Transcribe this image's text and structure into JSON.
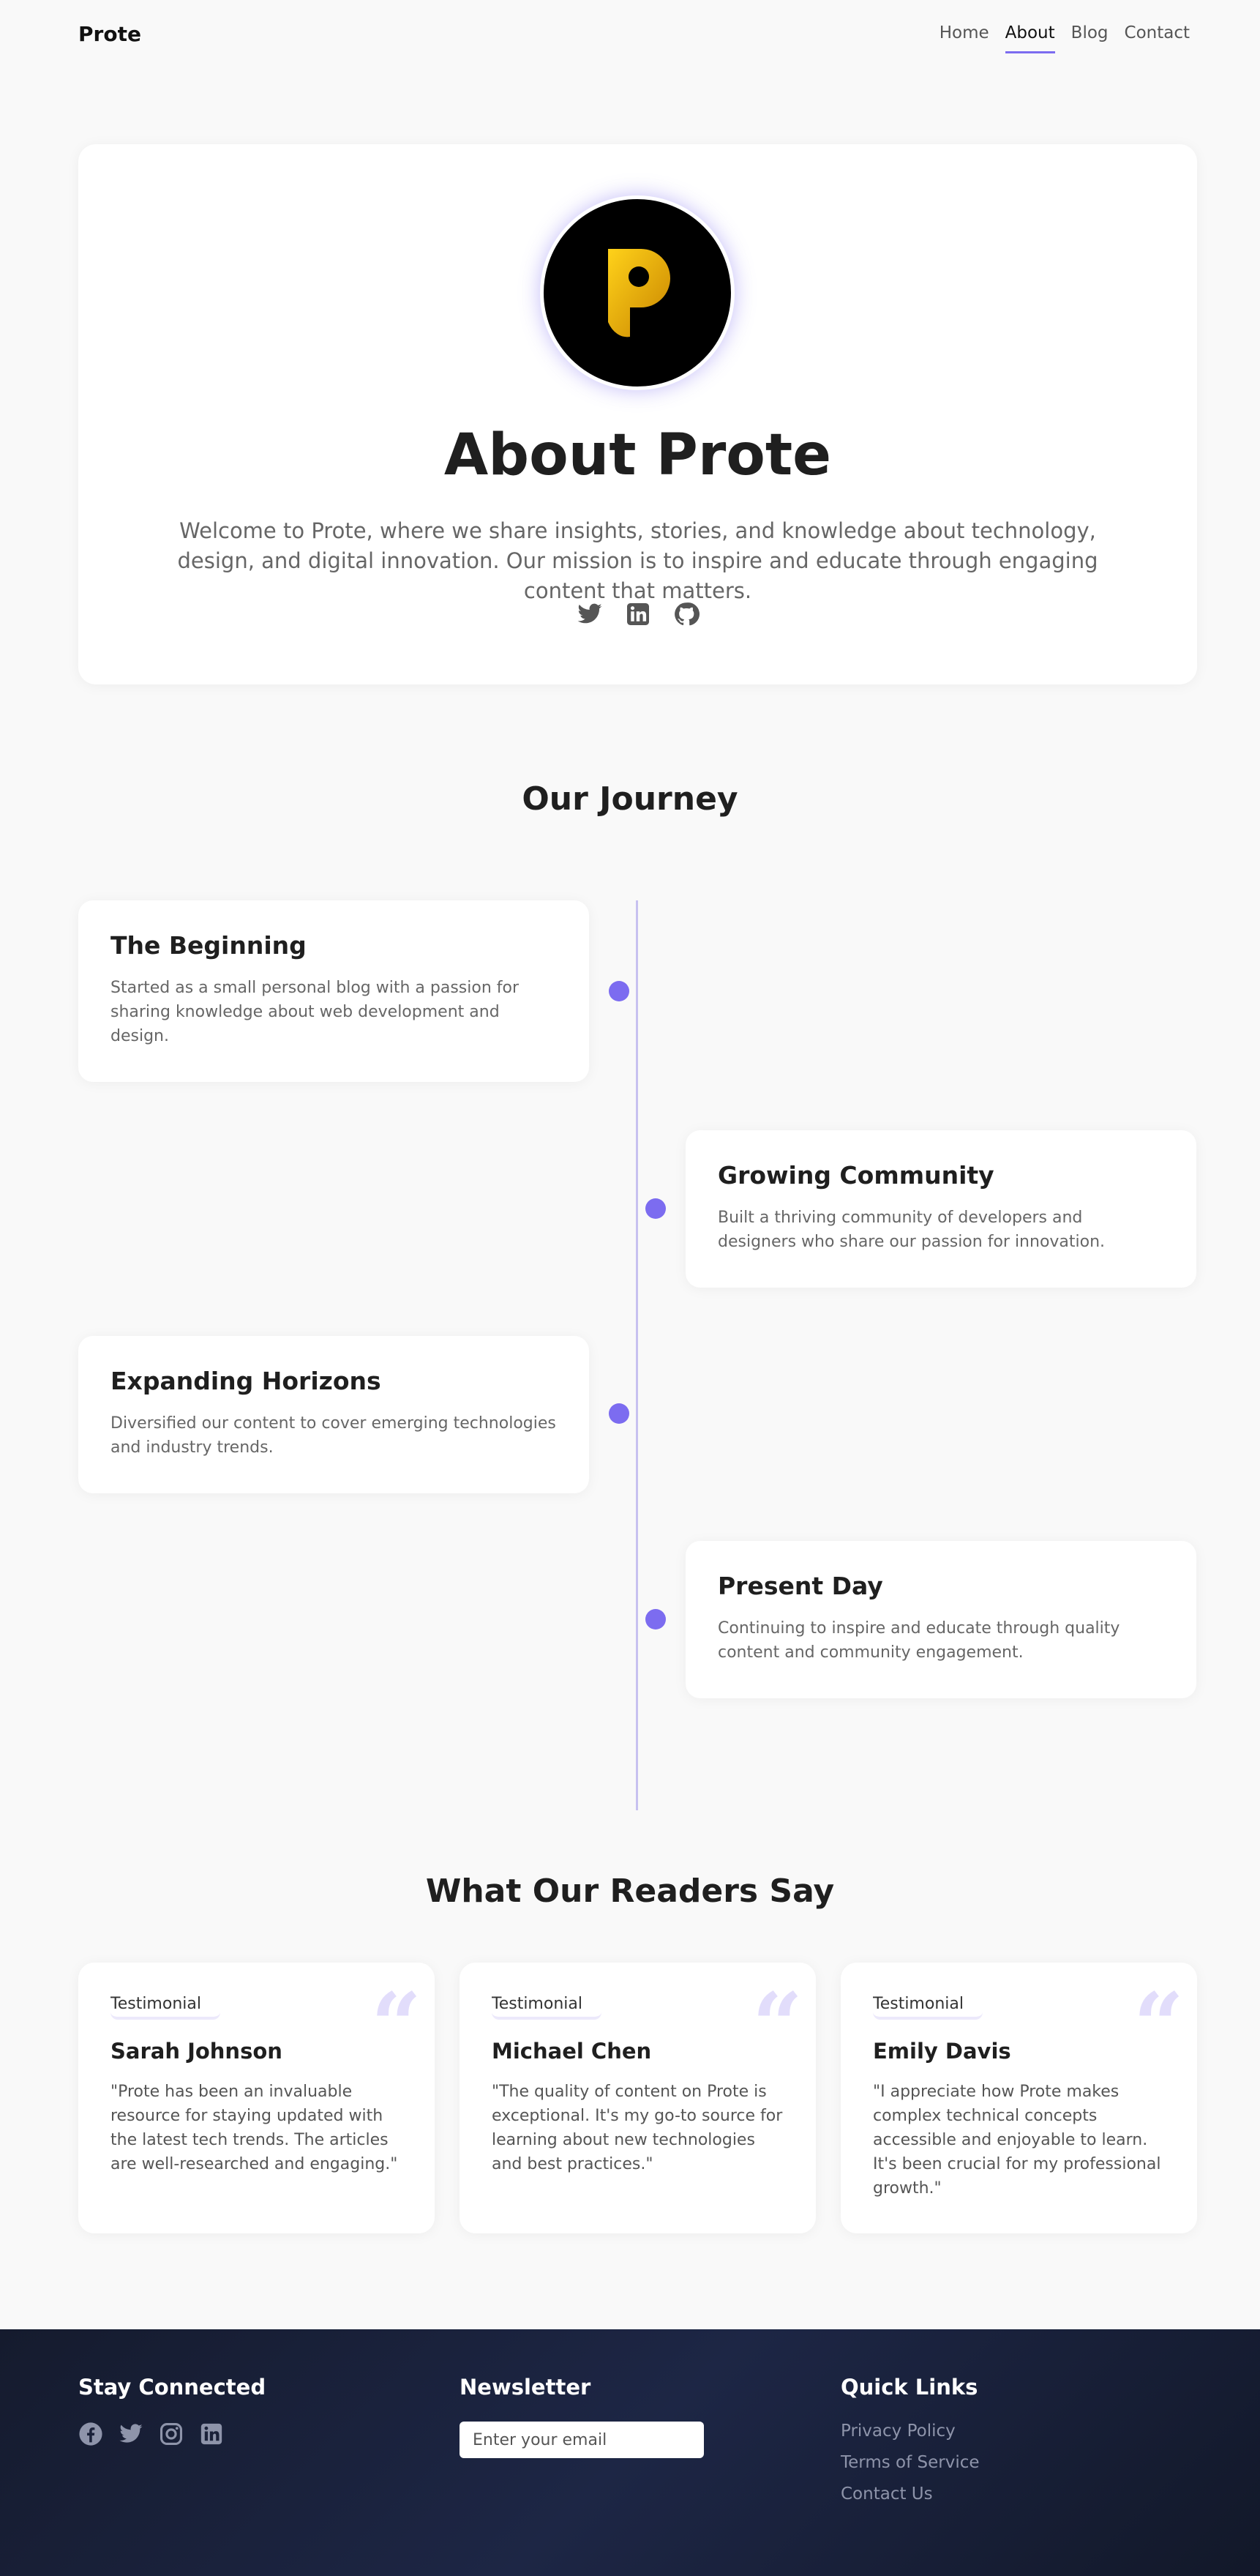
{
  "header": {
    "brand": "Prote",
    "nav": [
      {
        "label": "Home",
        "active": false
      },
      {
        "label": "About",
        "active": true
      },
      {
        "label": "Blog",
        "active": false
      },
      {
        "label": "Contact",
        "active": false
      }
    ]
  },
  "hero": {
    "logo_icon": "prote-p-logo-icon",
    "title": "About Prote",
    "description": "Welcome to Prote, where we share insights, stories, and knowledge about technology, design, and digital innovation. Our mission is to inspire and educate through engaging content that matters.",
    "social_icons": [
      "twitter-icon",
      "linkedin-icon",
      "github-icon"
    ]
  },
  "journey": {
    "title": "Our Journey",
    "items": [
      {
        "title": "The Beginning",
        "text": "Started as a small personal blog with a passion for sharing knowledge about web development and design."
      },
      {
        "title": "Growing Community",
        "text": "Built a thriving community of developers and designers who share our passion for innovation."
      },
      {
        "title": "Expanding Horizons",
        "text": "Diversified our content to cover emerging technologies and industry trends."
      },
      {
        "title": "Present Day",
        "text": "Continuing to inspire and educate through quality content and community engagement."
      }
    ]
  },
  "testimonials": {
    "title": "What Our Readers Say",
    "items": [
      {
        "avatar_alt": "Testimonial",
        "name": "Sarah Johnson",
        "text": "\"Prote has been an invaluable resource for staying updated with the latest tech trends. The articles are well-researched and engaging.\""
      },
      {
        "avatar_alt": "Testimonial",
        "name": "Michael Chen",
        "text": "\"The quality of content on Prote is exceptional. It's my go-to source for learning about new technologies and best practices.\""
      },
      {
        "avatar_alt": "Testimonial",
        "name": "Emily Davis",
        "text": "\"I appreciate how Prote makes complex technical concepts accessible and enjoyable to learn. It's been crucial for my professional growth.\""
      }
    ]
  },
  "footer": {
    "stay_connected": {
      "title": "Stay Connected",
      "icons": [
        "facebook-icon",
        "twitter-icon",
        "instagram-icon",
        "linkedin-icon"
      ]
    },
    "newsletter": {
      "title": "Newsletter",
      "placeholder": "Enter your email"
    },
    "quick_links": {
      "title": "Quick Links",
      "links": [
        "Privacy Policy",
        "Terms of Service",
        "Contact Us"
      ]
    }
  },
  "colors": {
    "accent": "#7c6cf0",
    "logo_gold": "#f5b800",
    "footer_bg": "#1d2645"
  }
}
